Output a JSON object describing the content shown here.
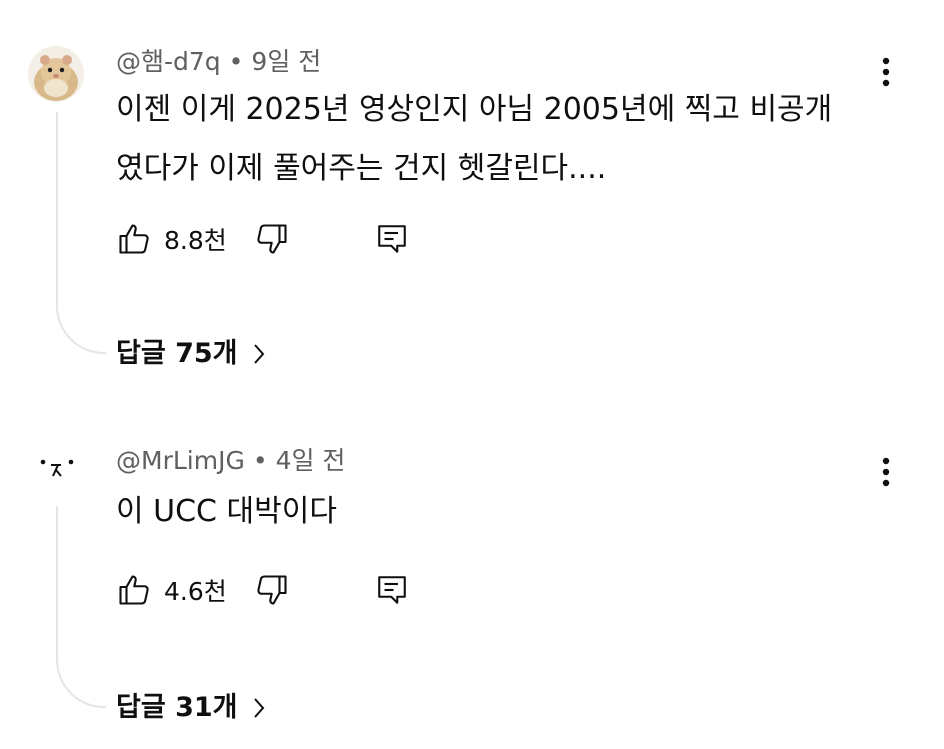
{
  "comments": [
    {
      "author": "@햄-d7q",
      "separator": "•",
      "time": "9일 전",
      "text": "이젠 이게 2025년 영상인지 아님 2005년에 찍고 비공개\n였다가 이제 풀어주는 건지 헷갈린다....",
      "likes": "8.8천",
      "replies_label": "답글 75개",
      "avatar_icon": "hamster-avatar-icon"
    },
    {
      "author": "@MrLimJG",
      "separator": "•",
      "time": "4일 전",
      "text": "이 UCC 대박이다",
      "likes": "4.6천",
      "replies_label": "답글 31개",
      "avatar_icon": "face-avatar-icon"
    }
  ],
  "colors": {
    "text": "#0f0f0f",
    "meta": "#606060",
    "thread_line": "#e5e5e5"
  }
}
